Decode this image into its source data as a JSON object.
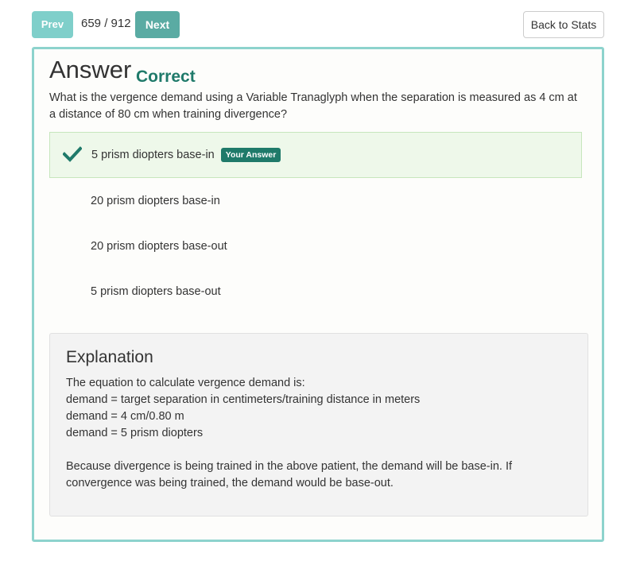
{
  "nav": {
    "prev_label": "Prev",
    "next_label": "Next",
    "counter": "659 / 912",
    "back_label": "Back to Stats"
  },
  "answer": {
    "heading": "Answer",
    "result": "Correct",
    "question": "What is the vergence demand using a Variable Tranaglyph when the separation is measured as 4 cm at a distance of 80 cm when training divergence?",
    "options": [
      {
        "label": "5 prism diopters base-in",
        "selected": true,
        "badge": "Your Answer"
      },
      {
        "label": "20 prism diopters base-in"
      },
      {
        "label": "20 prism diopters base-out"
      },
      {
        "label": "5 prism diopters base-out"
      }
    ]
  },
  "explanation": {
    "title": "Explanation",
    "lines": [
      "The equation to calculate vergence demand is:",
      "demand = target separation in centimeters/training distance in meters",
      "demand = 4 cm/0.80 m",
      "demand = 5 prism diopters"
    ],
    "paragraph": "Because divergence is being trained in the above patient, the demand will be base-in. If convergence was being trained, the demand would be base-out."
  },
  "colors": {
    "accent": "#8dd3cd",
    "correct": "#1f7a6a",
    "selected_bg": "#eef8ea"
  }
}
